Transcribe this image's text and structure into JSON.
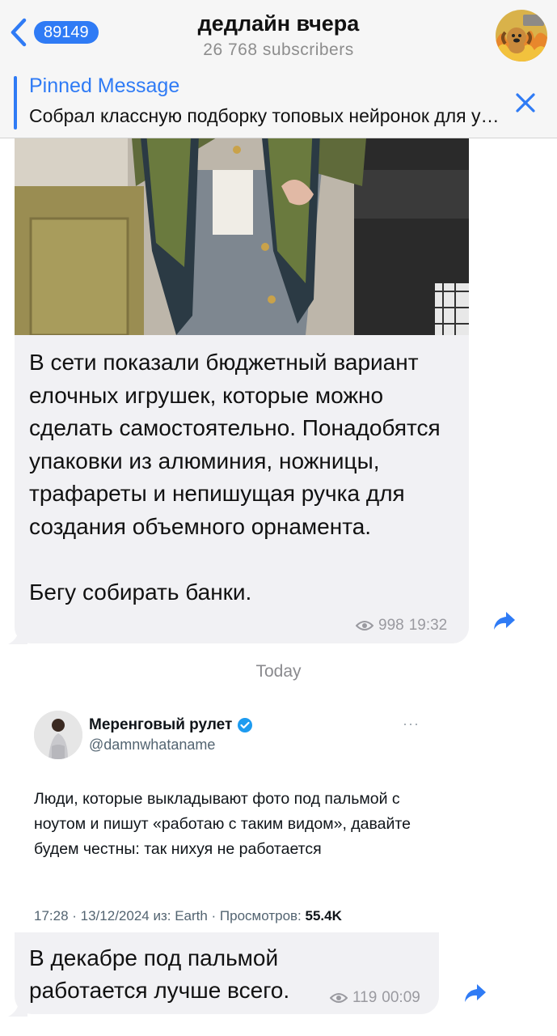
{
  "header": {
    "back_badge": "89149",
    "title": "дедлайн вчера",
    "subscribers": "26 768 subscribers"
  },
  "pinned": {
    "label": "Pinned Message",
    "text": "Собрал классную подборку топовых нейронок для учебы и работы"
  },
  "message1": {
    "text": "В сети показали бюджетный вариант елочных игрушек, которые можно сделать самостоятельно. Понадобятся упаковки из алюминия, ножницы, трафареты и непишущая ручка для создания объемного орнамента.\n\nБегу собирать банки.",
    "views": "998",
    "time": "19:32"
  },
  "date_separator": "Today",
  "tweet": {
    "name": "Меренговый рулет",
    "handle": "@damnwhataname",
    "more": "···",
    "body": "Люди, которые выкладывают фото под пальмой с ноутом и пишут «работаю с таким видом», давайте будем честны: так нихуя не работается",
    "meta_prefix": "17:28 · 13/12/2024 из: Earth · Просмотров: ",
    "meta_views": "55.4K"
  },
  "message2": {
    "text": "В декабре под пальмой\nработается лучше всего.",
    "views": "119",
    "time": "00:09"
  },
  "colors": {
    "accent": "#2f7bf5",
    "bubble": "#f1f1f4",
    "meta": "#9a9aa0"
  }
}
